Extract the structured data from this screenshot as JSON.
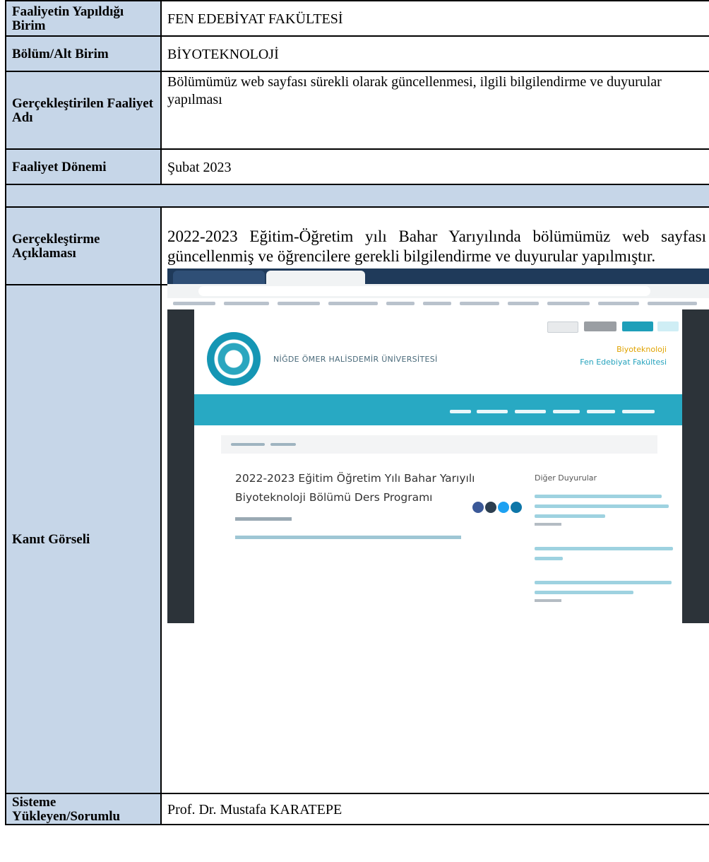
{
  "form": {
    "rows": [
      {
        "label": "Faaliyetin Yapıldığı Birim",
        "value": "FEN EDEBİYAT FAKÜLTESİ"
      },
      {
        "label": "Bölüm/Alt Birim",
        "value": "BİYOTEKNOLOJİ"
      },
      {
        "label": "Gerçekleştirilen Faaliyet Adı",
        "value": "Bölümümüz web sayfası sürekli olarak güncellenmesi, ilgili bilgilendirme ve duyurular yapılması"
      },
      {
        "label": "Faaliyet Dönemi",
        "value": "Şubat 2023"
      },
      {
        "label": "Gerçekleştirme Açıklaması",
        "value": "2022-2023 Eğitim-Öğretim yılı Bahar Yarıyılında bölümümüz web sayfası güncellenmiş ve öğrencilere gerekli bilgilendirme ve duyurular yapılmıştır."
      },
      {
        "label": "Kanıt Görseli",
        "value": ""
      },
      {
        "label": "Sisteme Yükleyen/Sorumlu",
        "value": "Prof. Dr. Mustafa KARATEPE"
      }
    ]
  },
  "screenshot": {
    "university": "NİĞDE ÖMER HALİSDEMİR ÜNİVERSİTESİ",
    "department": "Biyoteknoloji",
    "faculty": "Fen Edebiyat Fakültesi",
    "post_title": "2022-2023 Eğitim Öğretim Yılı Bahar Yarıyılı Biyoteknoloji Bölümü Ders Programı",
    "sidebar_heading": "Diğer Duyurular",
    "colors": {
      "teal": "#28a9c3",
      "tab_bar": "#1f3a5a",
      "label_bg": "#c6d6e8"
    }
  }
}
